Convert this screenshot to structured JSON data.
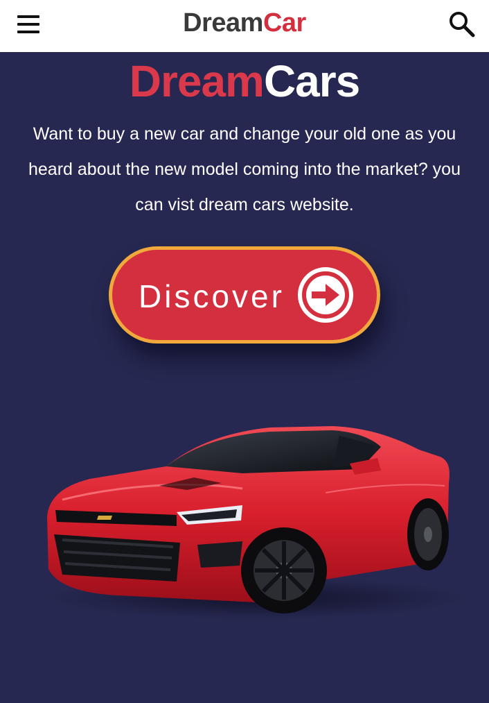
{
  "header": {
    "brand_part1": "Dream",
    "brand_part2": "Car",
    "menu_icon": "hamburger-menu-icon",
    "search_icon": "search-icon"
  },
  "hero": {
    "title_part1": "Dream",
    "title_part2": "Cars",
    "description": "Want to buy a new car and change your old one as you heard about the new model coming into the market? you can vist dream cars website.",
    "cta_label": "Discover",
    "cta_icon": "arrow-right-circle-icon"
  },
  "colors": {
    "background": "#262851",
    "accent_red": "#d32f3f",
    "button_border": "#f2a93b",
    "header_bg": "#ffffff"
  }
}
